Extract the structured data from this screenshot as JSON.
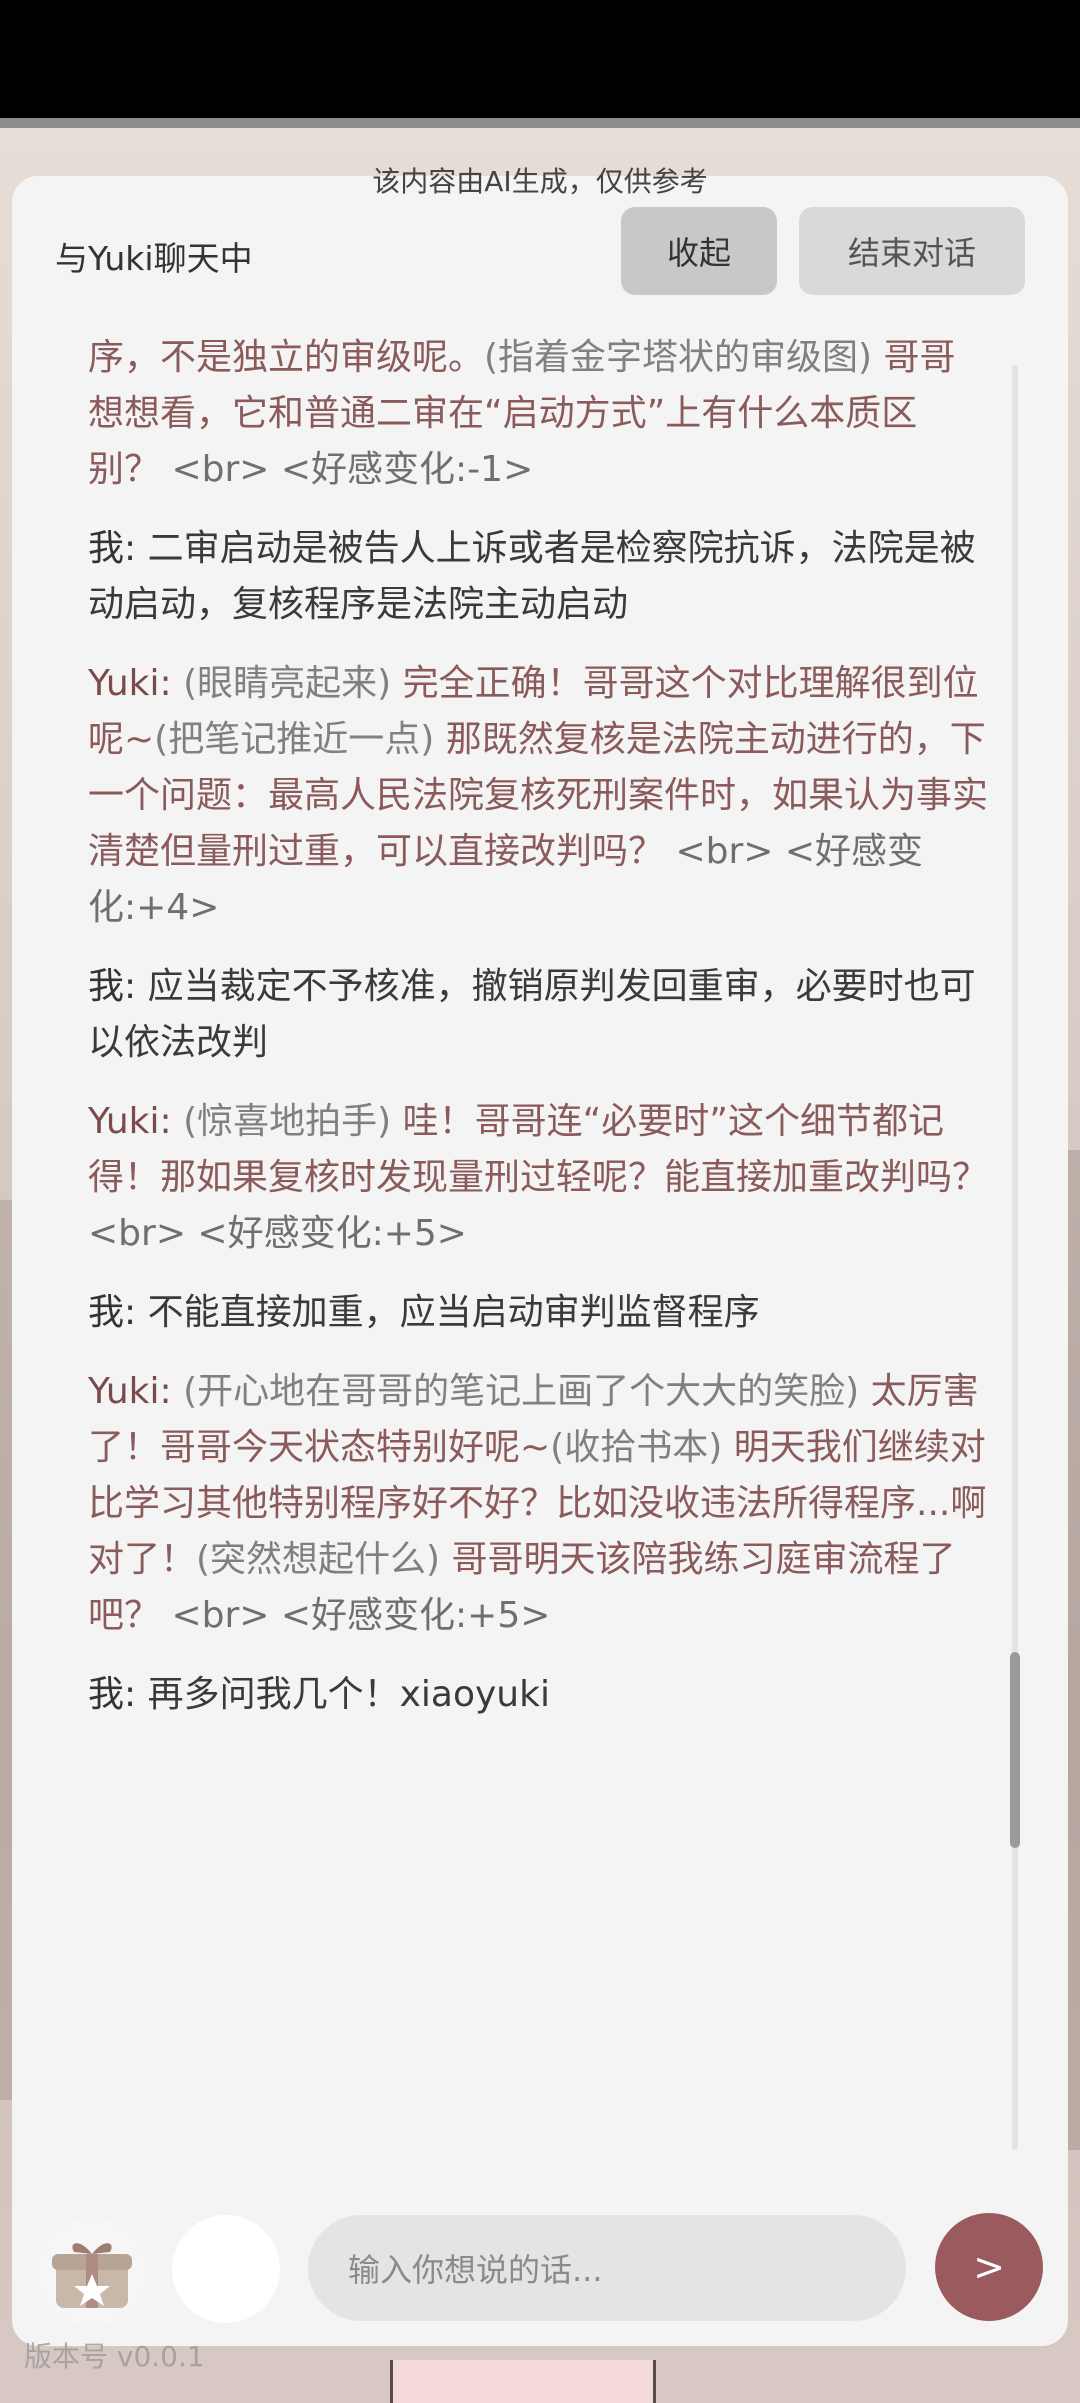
{
  "header": {
    "ai_notice": "该内容由AI生成，仅供参考",
    "title": "与Yuki聊天中",
    "collapse_label": "收起",
    "end_label": "结束对话"
  },
  "messages": [
    {
      "type": "yuki-cont",
      "parts": [
        {
          "kind": "speech",
          "text": "序，不是独立的审级呢。"
        },
        {
          "kind": "action",
          "text": "(指着金字塔状的审级图)"
        },
        {
          "kind": "speech",
          "text": " 哥哥想想看，它和普通二审在“启动方式”上有什么本质区别？"
        },
        {
          "kind": "meta",
          "text": " <br> <好感变化:-1>"
        }
      ]
    },
    {
      "type": "me",
      "who": "我: ",
      "text": "二审启动是被告人上诉或者是检察院抗诉，法院是被动启动，复核程序是法院主动启动"
    },
    {
      "type": "yuki",
      "who": "Yuki: ",
      "parts": [
        {
          "kind": "action",
          "text": "(眼睛亮起来)"
        },
        {
          "kind": "speech",
          "text": " 完全正确！哥哥这个对比理解很到位呢~"
        },
        {
          "kind": "action",
          "text": "(把笔记推近一点)"
        },
        {
          "kind": "speech",
          "text": " 那既然复核是法院主动进行的，下一个问题：最高人民法院复核死刑案件时，如果认为事实清楚但量刑过重，可以直接改判吗？"
        },
        {
          "kind": "meta",
          "text": " <br> <好感变化:+4>"
        }
      ]
    },
    {
      "type": "me",
      "who": "我: ",
      "text": "应当裁定不予核准，撤销原判发回重审，必要时也可以依法改判"
    },
    {
      "type": "yuki",
      "who": "Yuki: ",
      "parts": [
        {
          "kind": "action",
          "text": "(惊喜地拍手)"
        },
        {
          "kind": "speech",
          "text": " 哇！哥哥连“必要时”这个细节都记得！那如果复核时发现量刑过轻呢？能直接加重改判吗？"
        },
        {
          "kind": "meta",
          "text": " <br> <好感变化:+5>"
        }
      ]
    },
    {
      "type": "me",
      "who": "我: ",
      "text": "不能直接加重，应当启动审判监督程序"
    },
    {
      "type": "yuki",
      "who": "Yuki: ",
      "parts": [
        {
          "kind": "action",
          "text": "(开心地在哥哥的笔记上画了个大大的笑脸)"
        },
        {
          "kind": "speech",
          "text": " 太厉害了！哥哥今天状态特别好呢~"
        },
        {
          "kind": "action",
          "text": "(收拾书本)"
        },
        {
          "kind": "speech",
          "text": " 明天我们继续对比学习其他特别程序好不好？比如没收违法所得程序...啊对了！"
        },
        {
          "kind": "action",
          "text": "(突然想起什么)"
        },
        {
          "kind": "speech",
          "text": " 哥哥明天该陪我练习庭审流程了吧？"
        },
        {
          "kind": "meta",
          "text": " <br> <好感变化:+5>"
        }
      ]
    },
    {
      "type": "me",
      "who": "我: ",
      "text": "再多问我几个！xiaoyuki"
    }
  ],
  "input": {
    "placeholder": "输入你想说的话..."
  },
  "send_label": ">",
  "version_text": "版本号 v0.0.1",
  "colors": {
    "panel_bg": "#f4f4f4",
    "yuki_speech": "#8b5a5a",
    "action_gray": "#808080",
    "send_button": "#9a5a5e"
  },
  "icons": {
    "gift": "gift-box-icon",
    "send": "send-arrow-icon"
  }
}
